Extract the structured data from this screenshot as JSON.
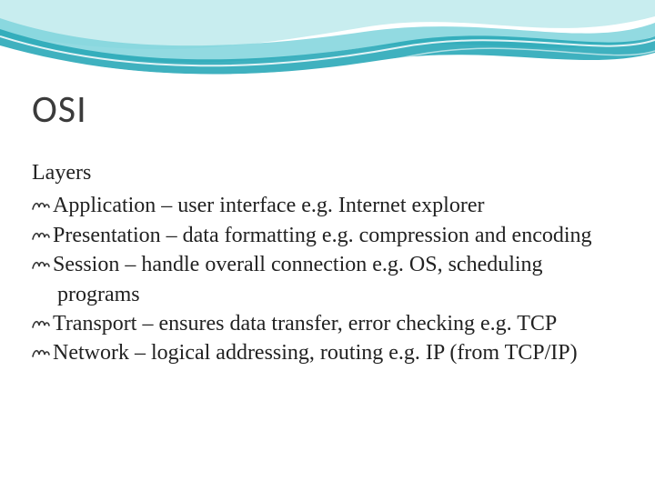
{
  "slide": {
    "title": "OSI",
    "subhead": "Layers",
    "bullet_glyph": "ℓ",
    "bullets": [
      "Application – user interface e.g. Internet explorer",
      "Presentation – data formatting e.g. compression and encoding",
      "Session – handle overall connection e.g. OS, scheduling programs",
      "Transport – ensures data transfer, error checking e.g. TCP",
      "Network – logical addressing, routing e.g. IP (from TCP/IP)"
    ]
  },
  "theme": {
    "wave_color_light": "#bfe9ec",
    "wave_color_mid": "#7fd3dc",
    "wave_color_dark": "#2aa8b8",
    "wave_edge": "#ffffff"
  }
}
